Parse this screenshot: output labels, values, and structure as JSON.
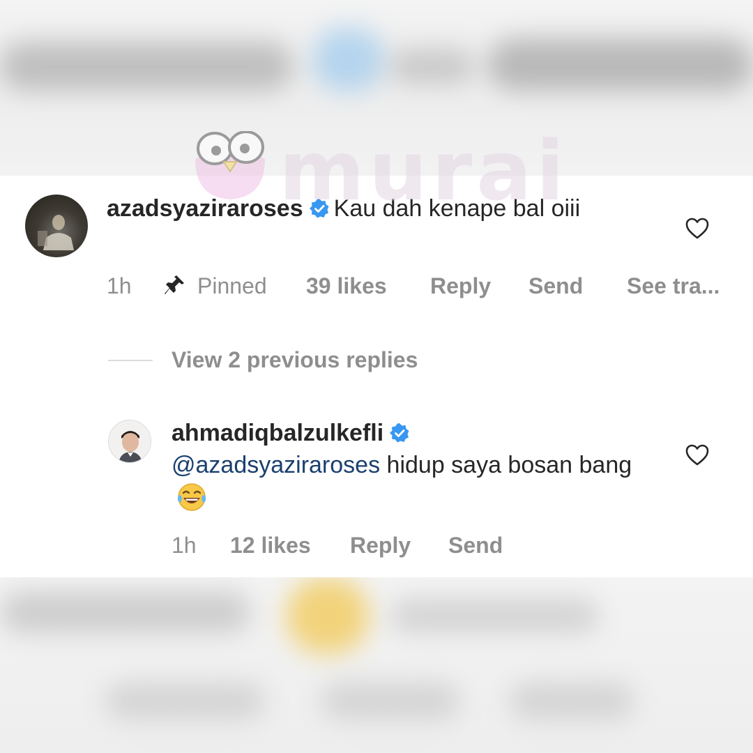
{
  "watermark": {
    "text": "murai"
  },
  "comments": [
    {
      "username": "azadsyaziraroses",
      "verified": true,
      "text": "Kau dah kenape bal oiii",
      "time": "1h",
      "pinned_label": "Pinned",
      "likes": "39 likes",
      "reply_label": "Reply",
      "send_label": "Send",
      "translate_label": "See tra..."
    }
  ],
  "view_replies": "View 2 previous replies",
  "replies": [
    {
      "username": "ahmadiqbalzulkefli",
      "verified": true,
      "mention": "@azadsyaziraroses",
      "text": "hidup saya bosan bang",
      "emoji": "face-with-tears-of-joy",
      "time": "1h",
      "likes": "12 likes",
      "reply_label": "Reply",
      "send_label": "Send"
    }
  ],
  "colors": {
    "text": "#262626",
    "meta": "#8e8e8e",
    "verified": "#3897f0",
    "mention": "#1b3f6f"
  }
}
